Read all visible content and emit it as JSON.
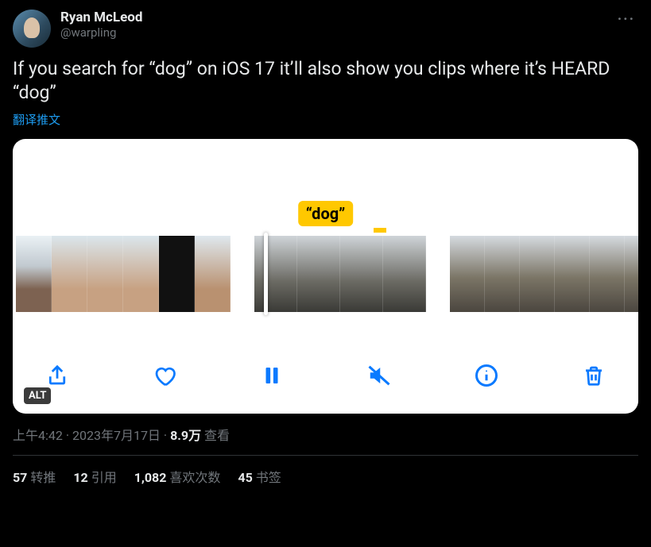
{
  "author": {
    "display_name": "Ryan McLeod",
    "handle": "@warpling"
  },
  "tweet_text": "If you search for “dog” on iOS 17 it’ll also show you clips where it’s HEARD “dog”",
  "translate_label": "翻译推文",
  "media": {
    "search_term_label": "“dog”",
    "alt_badge": "ALT",
    "toolbar_icons": {
      "share": "share-icon",
      "like": "heart-icon",
      "pause": "pause-icon",
      "mute": "mute-icon",
      "info": "info-icon",
      "trash": "trash-icon"
    }
  },
  "meta": {
    "time": "上午4:42",
    "separator": " · ",
    "date": "2023年7月17日",
    "views_num": "8.9万",
    "views_label": " 查看"
  },
  "stats": {
    "retweets_num": "57",
    "retweets_label": "转推",
    "quotes_num": "12",
    "quotes_label": "引用",
    "likes_num": "1,082",
    "likes_label": "喜欢次数",
    "bookmarks_num": "45",
    "bookmarks_label": "书签"
  }
}
